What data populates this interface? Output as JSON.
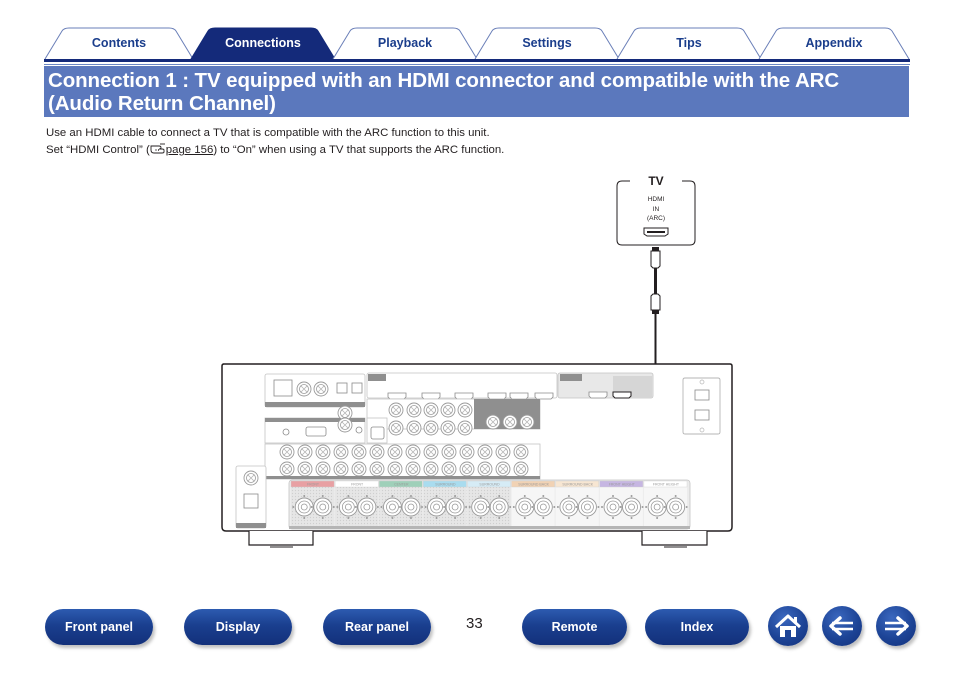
{
  "tabs": [
    {
      "label": "Contents",
      "active": false
    },
    {
      "label": "Connections",
      "active": true
    },
    {
      "label": "Playback",
      "active": false
    },
    {
      "label": "Settings",
      "active": false
    },
    {
      "label": "Tips",
      "active": false
    },
    {
      "label": "Appendix",
      "active": false
    }
  ],
  "heading": {
    "line1": "Connection 1 : TV equipped with an HDMI connector and compatible with the ARC",
    "line2": "(Audio Return Channel)"
  },
  "body": {
    "line1": "Use an HDMI cable to connect a TV that is compatible with the ARC function to this unit.",
    "line2_before": "Set “HDMI Control” (",
    "line2_link": "page 156",
    "line2_after": ") to “On” when using a TV that supports the ARC function.",
    "ref_icon": "pointing-hand-icon"
  },
  "diagram": {
    "tv": {
      "title": "TV",
      "port_line1": "HDMI",
      "port_line2": "IN",
      "port_line3": "(ARC)"
    },
    "receiver": {
      "speaker_groups": [
        {
          "label": "FRONT",
          "color": "#e8a0a3"
        },
        {
          "label": "FRONT",
          "color": "#ffffff"
        },
        {
          "label": "CENTER",
          "color": "#9fd0b9"
        },
        {
          "label": "SURROUND",
          "color": "#a9dcef"
        },
        {
          "label": "SURROUND",
          "color": "#d6ecf6"
        },
        {
          "label": "SURROUND BACK",
          "color": "#f1d2b4"
        },
        {
          "label": "SURROUND BACK",
          "color": "#f7e6d2"
        },
        {
          "label": "FRONT HEIGHT",
          "color": "#c6b6e2"
        },
        {
          "label": "FRONT HEIGHT",
          "color": "#ffffff"
        }
      ],
      "hdmi_inputs": 6,
      "hdmi_outputs": 2
    }
  },
  "page_number": "33",
  "nav": {
    "buttons": [
      {
        "label": "Front panel"
      },
      {
        "label": "Display"
      },
      {
        "label": "Rear panel"
      },
      {
        "label": "Remote"
      },
      {
        "label": "Index"
      }
    ],
    "icons": {
      "home": "home-icon",
      "back": "arrow-left-icon",
      "forward": "arrow-right-icon"
    }
  },
  "colors": {
    "brand_dark": "#142a7a",
    "heading_band": "#5b78bd",
    "tab_text": "#1b3e8c"
  }
}
